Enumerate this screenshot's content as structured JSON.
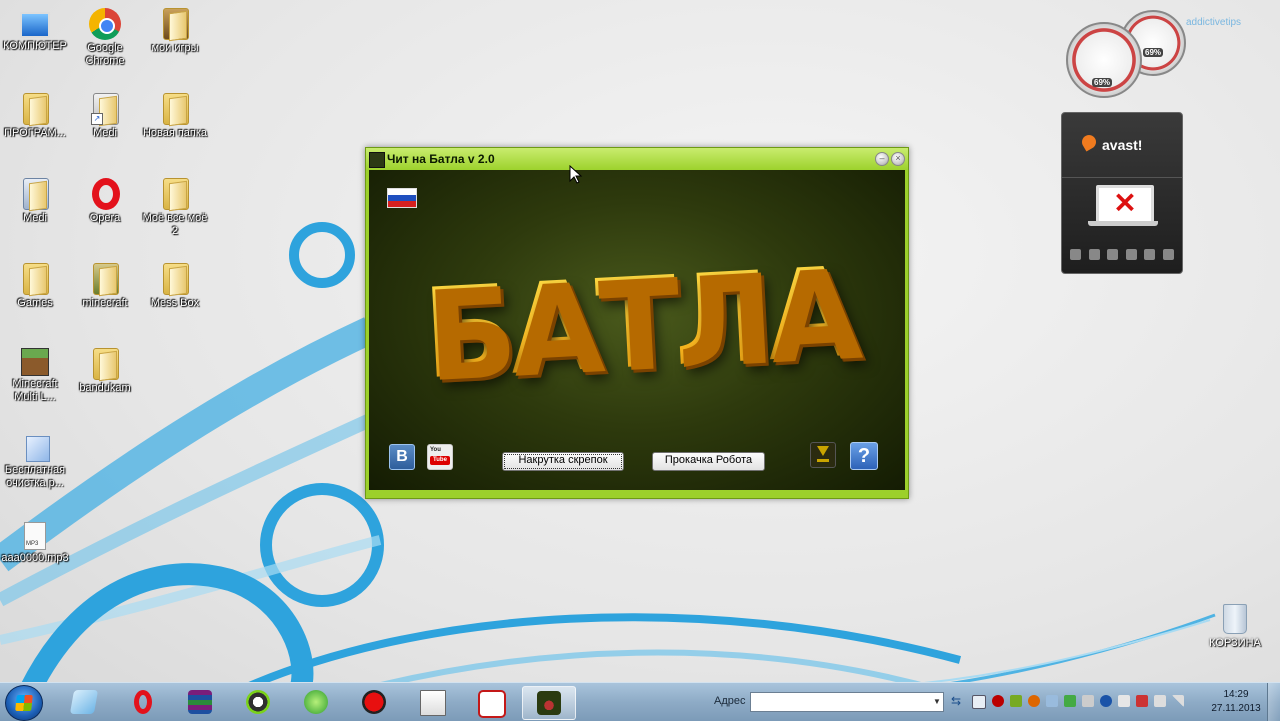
{
  "desktop": {
    "icons": [
      {
        "label": "КОМПЮТЕР"
      },
      {
        "label": "Google Chrome"
      },
      {
        "label": "мои игры"
      },
      {
        "label": "ПРОГРАМ..."
      },
      {
        "label": "Medi"
      },
      {
        "label": "Новая папка"
      },
      {
        "label": "Medi"
      },
      {
        "label": "Opera"
      },
      {
        "label": "Моё все моё 2"
      },
      {
        "label": "Games"
      },
      {
        "label": "minecraft"
      },
      {
        "label": "Mess Box"
      },
      {
        "label": "Minecraft Multi L..."
      },
      {
        "label": "bandukam"
      },
      {
        "label": "Бесплатная очистка р..."
      },
      {
        "label": "ааа0000.mp3"
      }
    ],
    "recycle_bin": "КОРЗИНА",
    "mp3_badge": "MP3"
  },
  "gadgets": {
    "gauge_big_value": "69%",
    "gauge_small_value": "69%",
    "brand": "addictivetips",
    "avast_logo": "avast!"
  },
  "app_window": {
    "title": "Чит на Батла v 2.0",
    "logo_text": "БАТЛА",
    "vk_label": "B",
    "youtube_you": "You",
    "youtube_tube": "Tube",
    "button_clips": "Накрутка скрепок",
    "button_robot": "Прокачка Робота",
    "help_label": "?",
    "flag_colors": [
      "#ffffff",
      "#1f4fbf",
      "#d62020"
    ]
  },
  "taskbar": {
    "address_label": "Адрес",
    "address_value": "",
    "clock_time": "14:29",
    "clock_date": "27.11.2013"
  },
  "colors": {
    "window_frame": "#9cd02b",
    "logo_orange": "#f5b314"
  }
}
